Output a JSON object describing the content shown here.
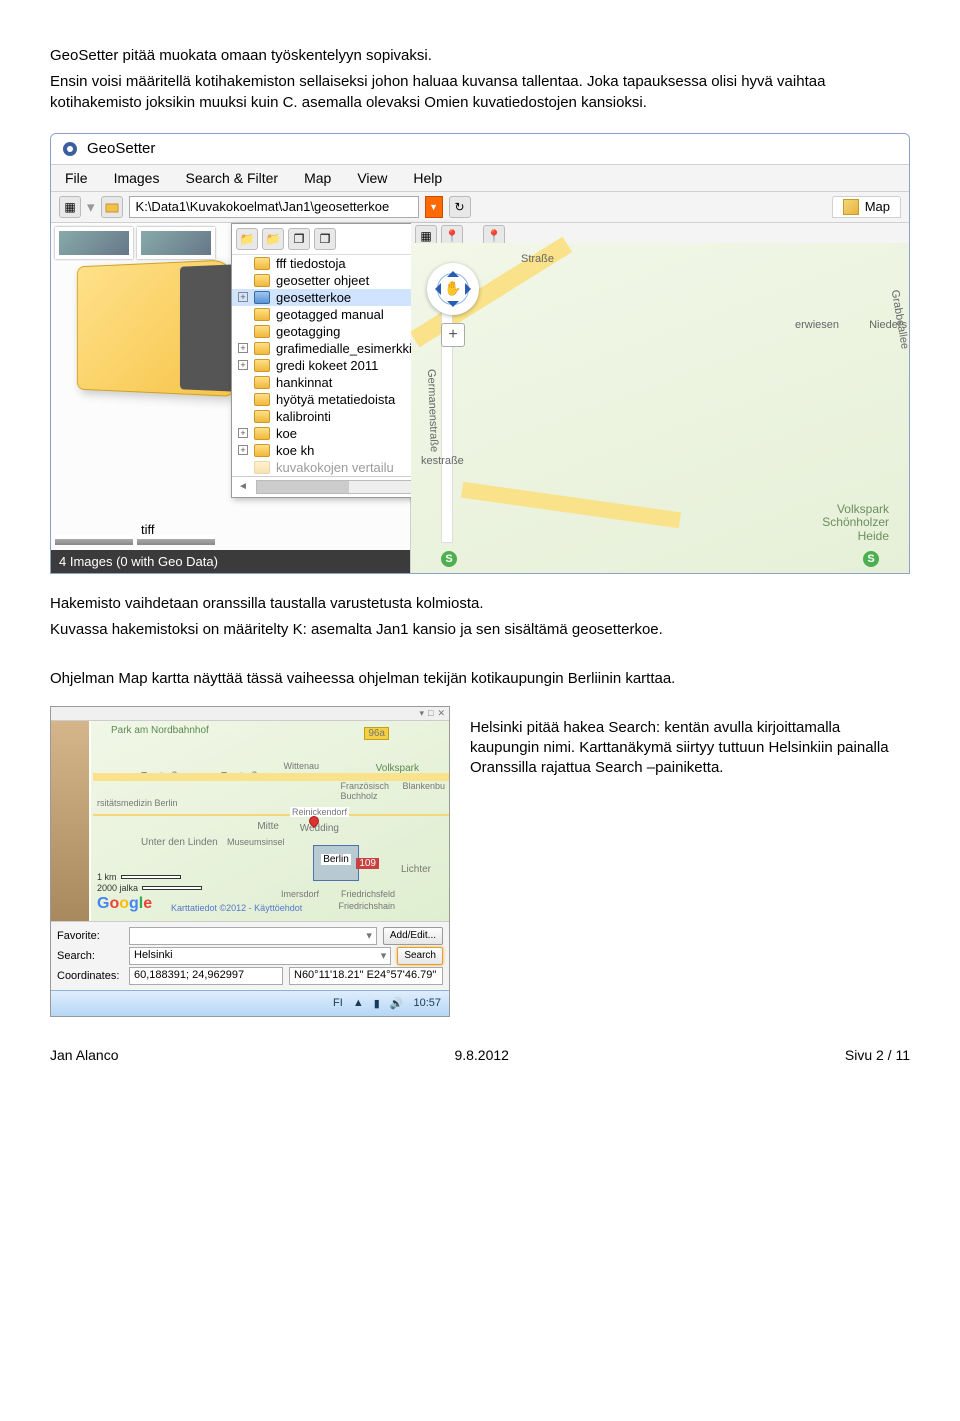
{
  "intro": {
    "p1": "GeoSetter pitää muokata omaan työskentelyyn sopivaksi.",
    "p2": "Ensin voisi määritellä kotihakemiston sellaiseksi johon haluaa kuvansa tallentaa. Joka tapauksessa olisi hyvä vaihtaa kotihakemisto joksikin muuksi kuin C. asemalla olevaksi Omien kuvatiedostojen kansioksi."
  },
  "app": {
    "title": "GeoSetter",
    "menu": {
      "file": "File",
      "images": "Images",
      "search": "Search & Filter",
      "map": "Map",
      "view": "View",
      "help": "Help"
    },
    "address": "K:\\Data1\\Kuvakokoelmat\\Jan1\\geosetterkoe",
    "map_tab": "Map",
    "folders": {
      "0": "fff tiedostoja",
      "1": "geosetter ohjeet",
      "2": "geosetterkoe",
      "3": "geotagged manual",
      "4": "geotagging",
      "5": "grafimedialle_esimerkki",
      "6": "gredi kokeet 2011",
      "7": "hankinnat",
      "8": "hyötyä metatiedoista",
      "9": "kalibrointi",
      "10": "koe",
      "11": "koe kh",
      "12": "kuvakokojen vertailu"
    },
    "folder_label": "tiff",
    "status": "4 Images (0 with Geo Data)",
    "map_labels": {
      "strasse": "Straße",
      "erwiesen": "erwiesen",
      "nieders": "Nieders",
      "germanen": "Germanenstraße",
      "grabbe": "Grabbeallee",
      "kestrasse": "kestraße",
      "park": "Volkspark\nSchönholzer\nHeide",
      "s": "S"
    }
  },
  "mid": {
    "p1": "Hakemisto vaihdetaan oranssilla taustalla varustetusta kolmiosta.",
    "p2": "Kuvassa hakemistoksi on määritelty K: asemalta Jan1 kansio ja sen sisältämä geosetterkoe.",
    "p3": "Ohjelman Map kartta näyttää tässä vaiheessa ohjelman tekijän kotikaupungin Berliinin karttaa."
  },
  "map2": {
    "parkam": "Park am\nNordbahnhof",
    "n96a": "96a",
    "torstrasse": "Torstraße",
    "berlin": "Berlin",
    "wedding": "Wedding",
    "mitte": "Mitte",
    "lichter": "Lichter",
    "unter": "Unter den Linden",
    "museum": "Museumsinsel",
    "volkspark": "Volkspark",
    "franz": "Französisch\nBuchholz",
    "blank": "Blankenbu",
    "wittenau": "Wittenau",
    "reinick": "Reinickendorf",
    "n109": "109",
    "fried": "Friedrichsfeld",
    "fried2": "Friedrichshain",
    "imers": "Imersdorf",
    "medizin": "rsitätsmedizin\nBerlin",
    "scale_km": "1 km",
    "scale_ft": "2000 jalka",
    "credit": "Karttatiedot ©2012 - Käyttöehdot"
  },
  "panel": {
    "fav_label": "Favorite:",
    "search_label": "Search:",
    "coord_label": "Coordinates:",
    "search_val": "Helsinki",
    "coord1": "60,188391; 24,962997",
    "coord2": "N60°11'18.21\" E24°57'46.79\"",
    "addedit_btn": "Add/Edit...",
    "search_btn": "Search"
  },
  "taskbar": {
    "lang": "FI",
    "time": "10:57"
  },
  "side": {
    "p": "Helsinki pitää hakea Search: kentän avulla kirjoittamalla kaupungin nimi. Karttanäkymä siirtyy tuttuun Helsinkiin painalla Oranssilla rajattua Search –painiketta."
  },
  "footer": {
    "author": "Jan Alanco",
    "date": "9.8.2012",
    "page": "Sivu 2 / 11"
  }
}
